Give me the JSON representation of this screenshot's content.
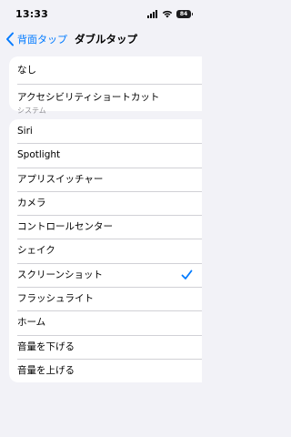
{
  "status": {
    "time": "13:33",
    "battery": "84"
  },
  "nav": {
    "back_label": "背面タップ",
    "title": "ダブルタップ"
  },
  "options_top": [
    {
      "label": "なし"
    },
    {
      "label": "アクセシビリティショートカット"
    }
  ],
  "section_header": "システム",
  "system_options": [
    {
      "label": "Siri",
      "selected": false
    },
    {
      "label": "Spotlight",
      "selected": false
    },
    {
      "label": "アプリスイッチャー",
      "selected": false
    },
    {
      "label": "カメラ",
      "selected": false
    },
    {
      "label": "コントロールセンター",
      "selected": false
    },
    {
      "label": "シェイク",
      "selected": false
    },
    {
      "label": "スクリーンショット",
      "selected": true
    },
    {
      "label": "フラッシュライト",
      "selected": false
    },
    {
      "label": "ホーム",
      "selected": false
    },
    {
      "label": "音量を下げる",
      "selected": false
    },
    {
      "label": "音量を上げる",
      "selected": false
    }
  ],
  "colors": {
    "accent": "#007aff",
    "background": "#f2f2f7"
  }
}
